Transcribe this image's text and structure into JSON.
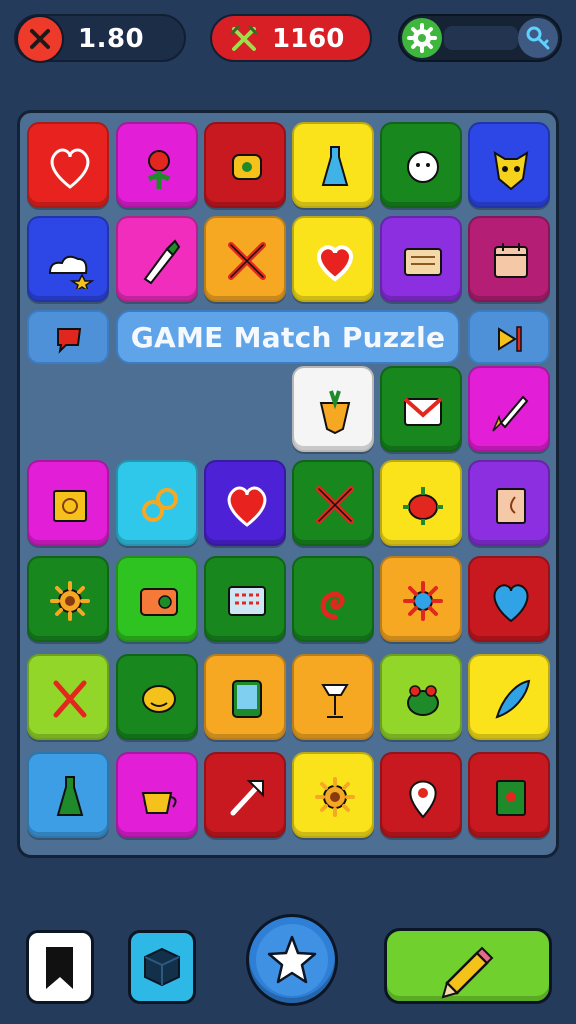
{
  "hud": {
    "left_value": "1.80",
    "left_icon": "close-icon",
    "middle_value": "1160",
    "middle_icon": "crossed-swords-icon",
    "right_icons": [
      "gear-icon",
      "key-icon"
    ]
  },
  "banner": {
    "title": "GAME Match Puzzle"
  },
  "colors": {
    "background": "#243b5c",
    "board": "#4d6f93",
    "red": "#e8231f",
    "magenta": "#e21fd6",
    "dark_red": "#c81820",
    "yellow": "#fae31a",
    "green": "#17871e",
    "blue": "#2d46e6",
    "pink": "#f02dbd",
    "orange": "#f7a823",
    "purple": "#8b2fe0",
    "plum": "#b51e75",
    "cyan": "#2fc7ea",
    "indigo": "#4d22d6",
    "sky": "#3d9ee6",
    "lime_green": "#2ec320",
    "yellow_green": "#93d62a",
    "white": "#f5f5f5",
    "dark_green": "#1f6a24",
    "light_blue": "#4a92df"
  },
  "grid": {
    "rows": [
      [
        "red",
        "magenta",
        "dark_red",
        "yellow",
        "green",
        "blue"
      ],
      [
        "blue",
        "pink",
        "orange",
        "yellow",
        "purple",
        "plum"
      ],
      [
        "sky",
        "orange",
        "dark_red",
        "white",
        "green",
        "magenta"
      ],
      [
        "magenta",
        "cyan",
        "indigo",
        "green",
        "yellow",
        "purple"
      ],
      [
        "green",
        "lime_green",
        "green",
        "green",
        "orange",
        "dark_red"
      ],
      [
        "yellow_green",
        "green",
        "orange",
        "orange",
        "yellow_green",
        "yellow"
      ],
      [
        "sky",
        "magenta",
        "dark_red",
        "yellow",
        "dark_red",
        "dark_red"
      ]
    ],
    "icons": [
      [
        "heart-icon",
        "flower-icon",
        "robot-face-icon",
        "bottle-icon",
        "cloud-face-icon",
        "cat-face-icon"
      ],
      [
        "cloud-star-icon",
        "brush-icon",
        "crossed-swords-icon",
        "heart-bubble-icon",
        "message-icon",
        "calendar-icon"
      ],
      [
        null,
        null,
        null,
        "carrot-face-icon",
        "envelope-icon",
        "rocket-icon"
      ],
      [
        "picture-frame-icon",
        "rings-icon",
        "heart-icon",
        "crossed-swords-icon",
        "turtle-icon",
        "book-icon"
      ],
      [
        "gear-icon",
        "camera-icon",
        "keypad-icon",
        "spiral-icon",
        "sun-gear-icon",
        "heart-face-icon"
      ],
      [
        "crossed-sticks-icon",
        "smile-face-icon",
        "tablet-icon",
        "goblet-icon",
        "frog-icon",
        "feather-icon"
      ],
      [
        "potion-icon",
        "teacup-icon",
        "arrow-icon",
        "gear-icon",
        "map-pin-icon",
        "picture-icon"
      ]
    ],
    "row_three_side_icons": [
      "speech-bubble-icon",
      "play-flag-icon"
    ]
  },
  "bottom_bar": {
    "buttons": [
      "bookmark-icon",
      "cube-icon",
      "star-icon",
      "pencil-icon"
    ]
  }
}
